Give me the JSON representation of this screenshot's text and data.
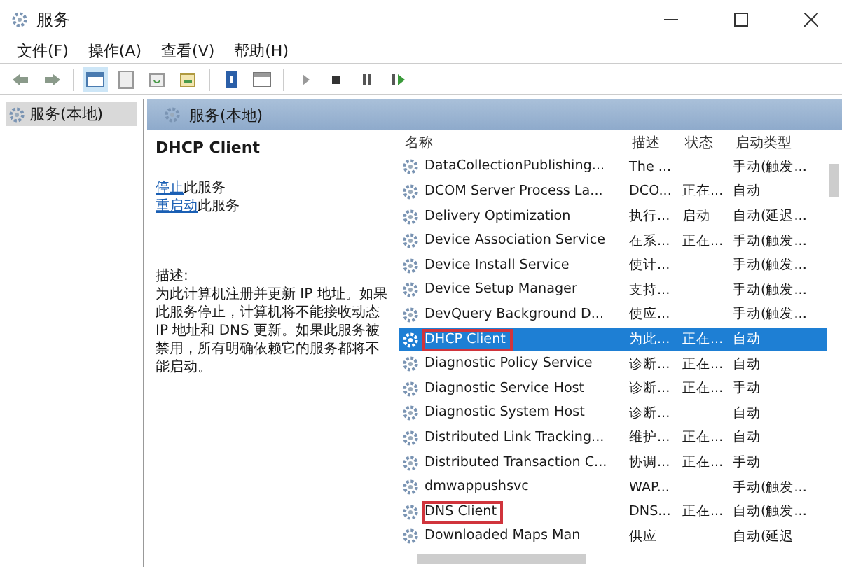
{
  "window": {
    "title": "服务"
  },
  "menu": [
    "文件(F)",
    "操作(A)",
    "查看(V)",
    "帮助(H)"
  ],
  "tree": {
    "items": [
      {
        "label": "服务(本地)",
        "selected": true
      }
    ]
  },
  "panel_header": "服务(本地)",
  "details": {
    "title": "DHCP Client",
    "actions": [
      {
        "link": "停止",
        "text": "此服务"
      },
      {
        "link": "重启动",
        "text": "此服务"
      }
    ],
    "description_label": "描述:",
    "description": "为此计算机注册并更新 IP 地址。如果此服务停止，计算机将不能接收动态 IP 地址和 DNS 更新。如果此服务被禁用，所有明确依赖它的服务都将不能启动。"
  },
  "table": {
    "columns": [
      "名称",
      "描述",
      "状态",
      "启动类型"
    ],
    "rows": [
      {
        "name": "DataCollectionPublishing...",
        "description": "The ...",
        "status": "",
        "startup": "手动(触发...",
        "selected": false,
        "highlighted": false
      },
      {
        "name": "DCOM Server Process La...",
        "description": "DCO...",
        "status": "正在...",
        "startup": "自动",
        "selected": false,
        "highlighted": false
      },
      {
        "name": "Delivery Optimization",
        "description": "执行...",
        "status": "启动",
        "startup": "自动(延迟...",
        "selected": false,
        "highlighted": false
      },
      {
        "name": "Device Association Service",
        "description": "在系...",
        "status": "正在...",
        "startup": "手动(触发...",
        "selected": false,
        "highlighted": false
      },
      {
        "name": "Device Install Service",
        "description": "使计...",
        "status": "",
        "startup": "手动(触发...",
        "selected": false,
        "highlighted": false
      },
      {
        "name": "Device Setup Manager",
        "description": "支持...",
        "status": "",
        "startup": "手动(触发...",
        "selected": false,
        "highlighted": false
      },
      {
        "name": "DevQuery Background D...",
        "description": "使应...",
        "status": "",
        "startup": "手动(触发...",
        "selected": false,
        "highlighted": false
      },
      {
        "name": "DHCP Client",
        "description": "为此...",
        "status": "正在...",
        "startup": "自动",
        "selected": true,
        "highlighted": true
      },
      {
        "name": "Diagnostic Policy Service",
        "description": "诊断...",
        "status": "正在...",
        "startup": "自动",
        "selected": false,
        "highlighted": false
      },
      {
        "name": "Diagnostic Service Host",
        "description": "诊断...",
        "status": "正在...",
        "startup": "手动",
        "selected": false,
        "highlighted": false
      },
      {
        "name": "Diagnostic System Host",
        "description": "诊断...",
        "status": "",
        "startup": "自动",
        "selected": false,
        "highlighted": false
      },
      {
        "name": "Distributed Link Tracking...",
        "description": "维护...",
        "status": "正在...",
        "startup": "自动",
        "selected": false,
        "highlighted": false
      },
      {
        "name": "Distributed Transaction C...",
        "description": "协调...",
        "status": "正在...",
        "startup": "手动",
        "selected": false,
        "highlighted": false
      },
      {
        "name": "dmwappushsvc",
        "description": "WAP...",
        "status": "",
        "startup": "手动(触发...",
        "selected": false,
        "highlighted": false
      },
      {
        "name": "DNS Client",
        "description": "DNS...",
        "status": "正在...",
        "startup": "自动(触发...",
        "selected": false,
        "highlighted": true
      },
      {
        "name": "Downloaded Maps Man",
        "description": "供应",
        "status": "",
        "startup": "自动(延迟",
        "selected": false,
        "highlighted": false
      }
    ]
  }
}
